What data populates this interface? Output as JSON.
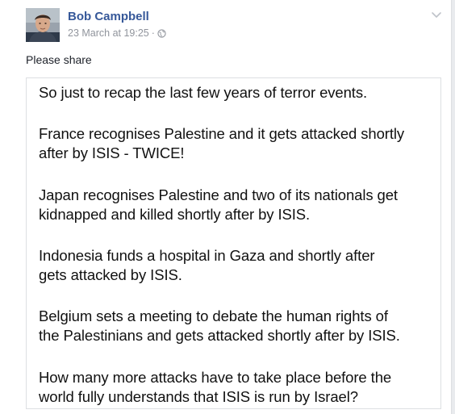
{
  "post": {
    "author": "Bob Campbell",
    "timestamp": "23 March at 19:25",
    "separator": "·",
    "privacy_icon": "globe-icon",
    "menu_icon": "chevron-down-icon",
    "status_text": "Please share"
  },
  "shared_image": {
    "paragraphs": [
      {
        "lines": [
          "So just to recap the last few years of terror events."
        ]
      },
      {
        "lines": [
          "France recognises Palestine and it gets attacked shortly",
          "after by ISIS - TWICE!"
        ]
      },
      {
        "lines": [
          "Japan recognises Palestine and two of its nationals get",
          "kidnapped and killed shortly after by ISIS."
        ]
      },
      {
        "lines": [
          "Indonesia funds a hospital in Gaza and shortly after",
          "gets attacked by ISIS."
        ]
      },
      {
        "lines": [
          "Belgium sets a meeting to debate the human rights of",
          "the Palestinians and gets attacked shortly after by ISIS."
        ]
      },
      {
        "lines": [
          "How many more attacks have to take place before the",
          "world fully understands that ISIS is run by Israel?"
        ]
      }
    ]
  },
  "colors": {
    "author": "#365899",
    "meta": "#90949c",
    "body_text": "#1d2129",
    "border": "#dddfe2",
    "page_bg": "#e9ebee"
  }
}
